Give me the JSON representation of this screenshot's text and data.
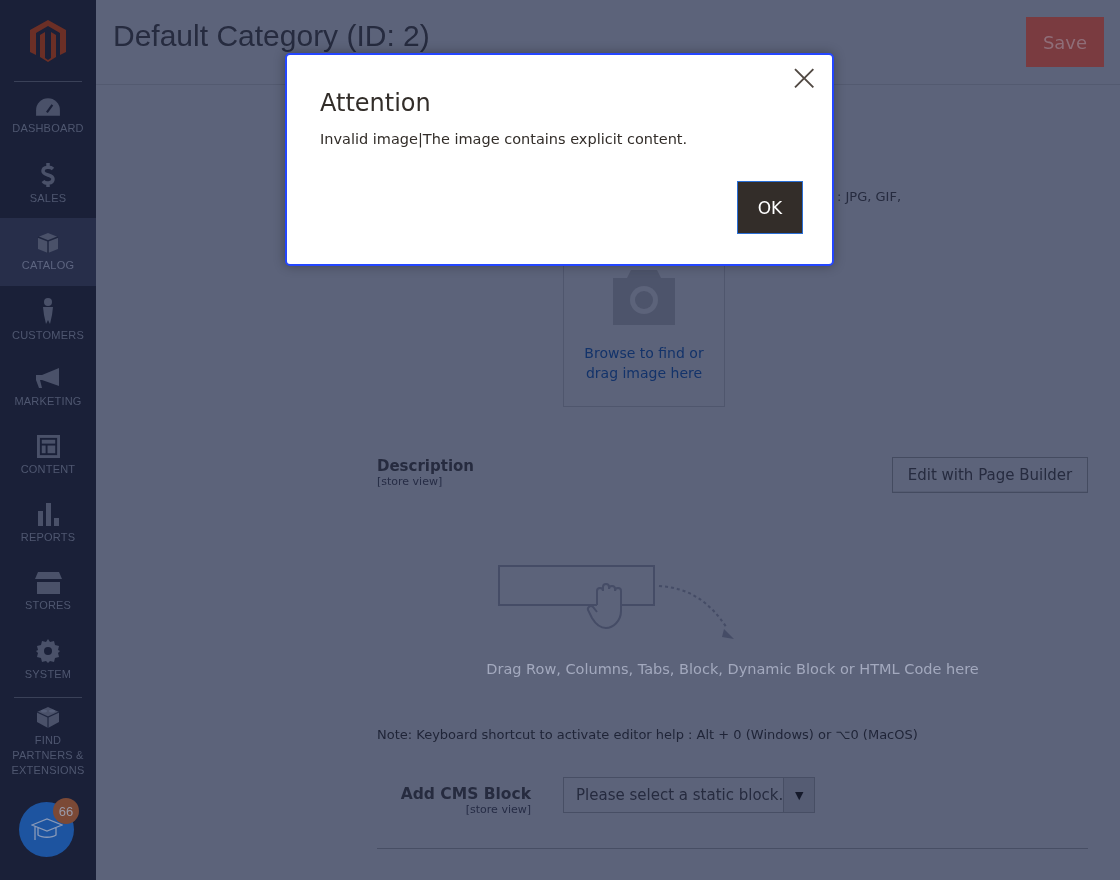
{
  "sidebar": {
    "items": [
      {
        "label": "DASHBOARD",
        "selected": false
      },
      {
        "label": "SALES",
        "selected": false
      },
      {
        "label": "CATALOG",
        "selected": true
      },
      {
        "label": "CUSTOMERS",
        "selected": false
      },
      {
        "label": "MARKETING",
        "selected": false
      },
      {
        "label": "CONTENT",
        "selected": false
      },
      {
        "label": "REPORTS",
        "selected": false
      },
      {
        "label": "STORES",
        "selected": false
      },
      {
        "label": "SYSTEM",
        "selected": false
      },
      {
        "label": "FIND PARTNERS & EXTENSIONS",
        "selected": false
      }
    ],
    "help_badge": "66"
  },
  "header": {
    "title": "Default Category (ID: 2)",
    "save_button": "Save"
  },
  "form": {
    "image_hint": ": JPG, GIF,",
    "upload_link": "Browse to find or drag image here",
    "description": {
      "label": "Description",
      "scope": "[store view]",
      "button": "Edit with Page Builder",
      "drop_hint": "Drag Row, Columns, Tabs, Block, Dynamic Block or HTML Code here"
    },
    "note": "Note: Keyboard shortcut to activate editor help : Alt + 0 (Windows) or ⌥0 (MacOS)",
    "cms_block": {
      "label": "Add CMS Block",
      "scope": "[store view]",
      "placeholder": "Please select a static block.",
      "caret": "▼"
    }
  },
  "modal": {
    "title": "Attention",
    "message": "Invalid image|The image contains explicit content.",
    "close": "×",
    "button": "OK"
  }
}
